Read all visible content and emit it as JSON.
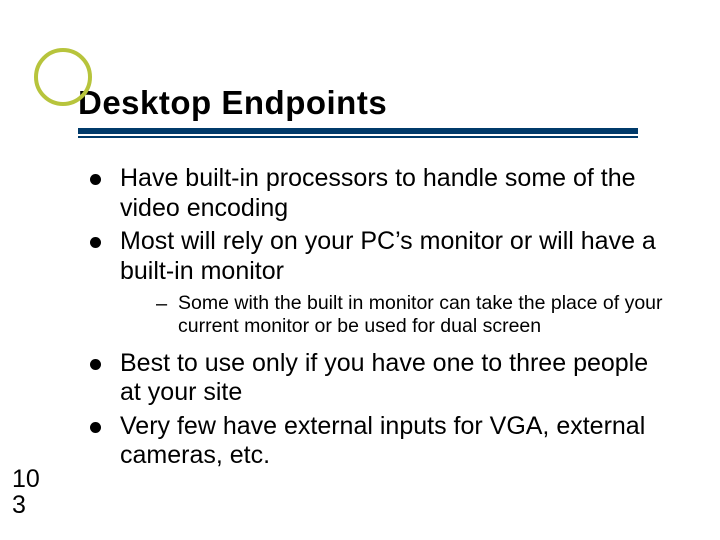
{
  "theme": {
    "accent": "#b7c43c",
    "rule": "#003a6a"
  },
  "title": "Desktop Endpoints",
  "bullets": {
    "b1": "Have built-in processors to handle some of the video encoding",
    "b2": "Most will rely on your PC’s monitor or will have a built-in monitor",
    "b2_sub1": "Some with the built in monitor can take the place of your current monitor or be used for dual screen",
    "b3": "Best to use only if you have one to three people at your site",
    "b4": "Very few have external inputs for VGA, external cameras, etc."
  },
  "page": {
    "line1": "10",
    "line2": "3"
  }
}
